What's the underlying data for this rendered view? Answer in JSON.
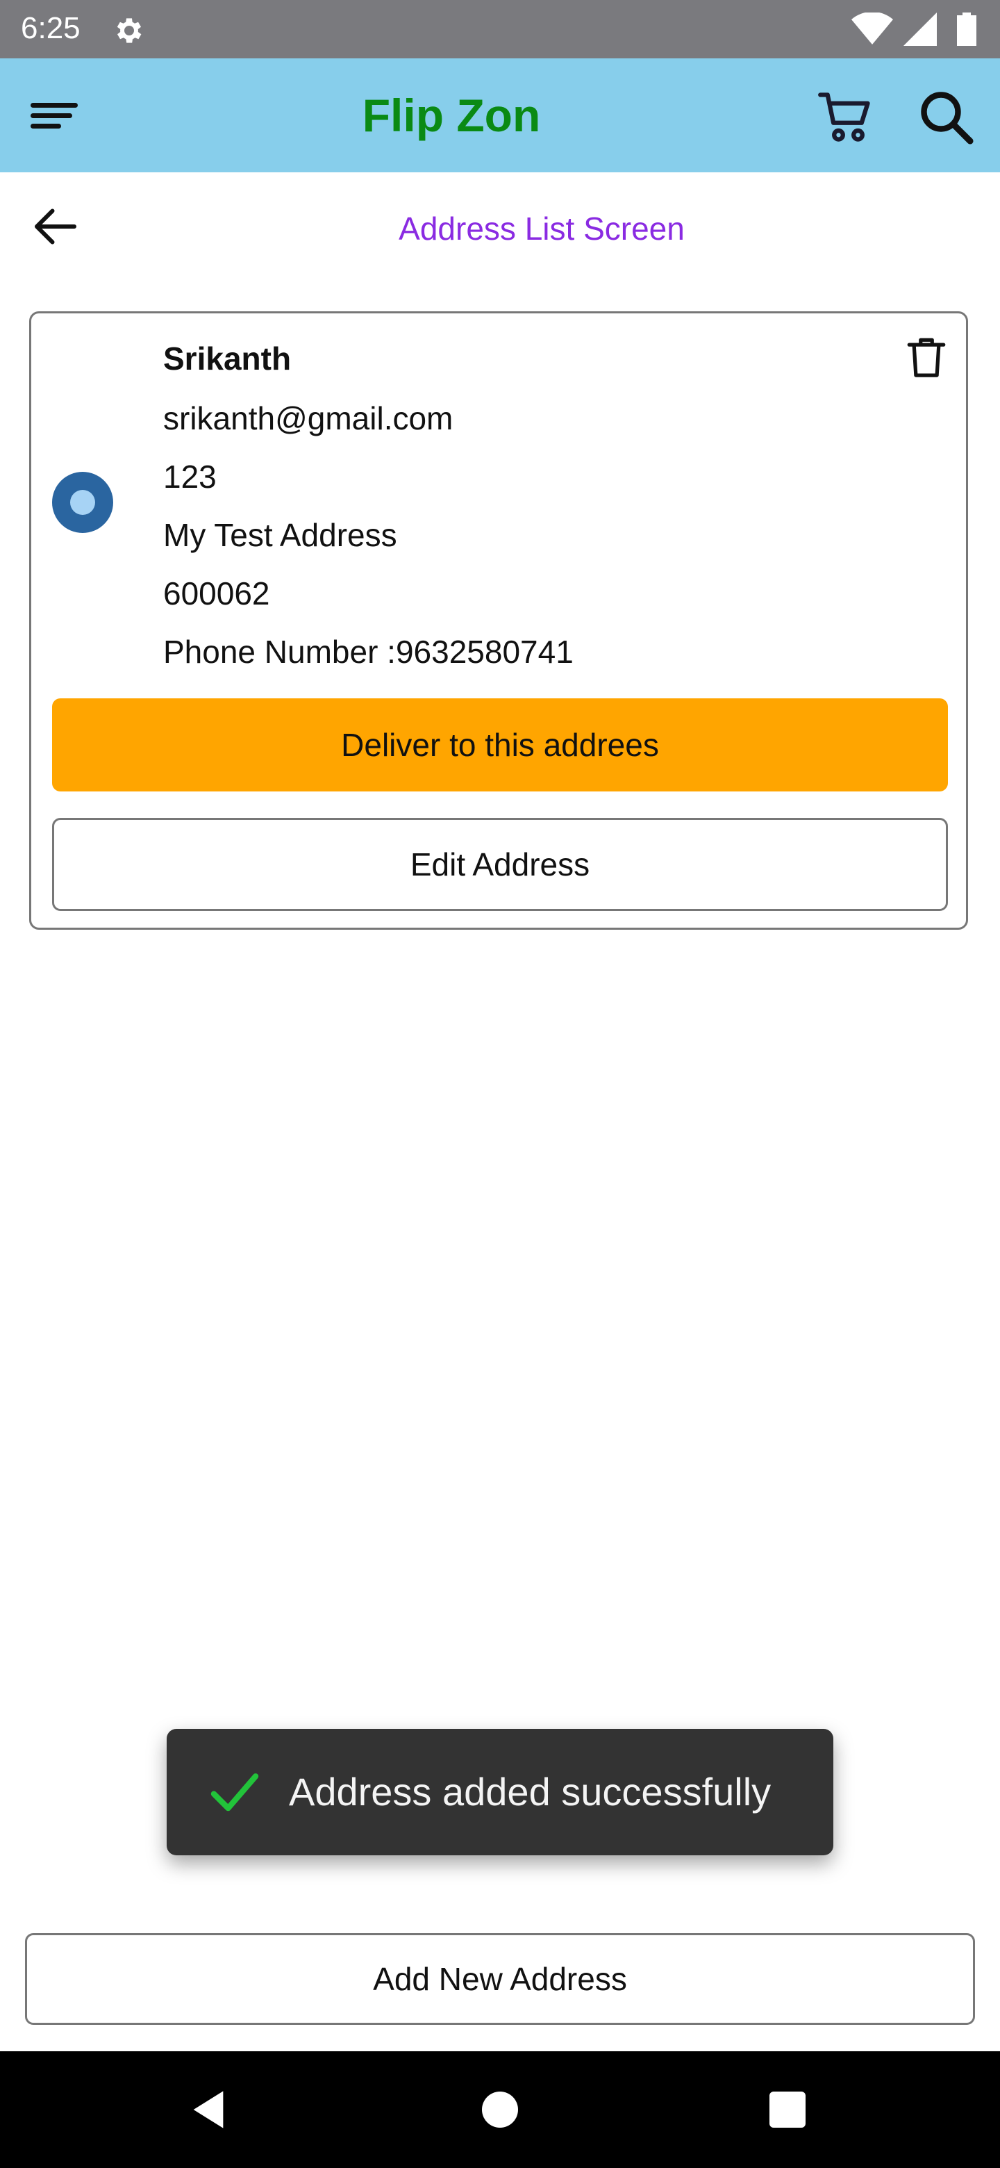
{
  "status_bar": {
    "time": "6:25"
  },
  "app_bar": {
    "title": "Flip Zon"
  },
  "screen": {
    "title": "Address List Screen"
  },
  "address": {
    "name": "Srikanth",
    "email": "srikanth@gmail.com",
    "house": "123",
    "street": "My Test Address",
    "pincode": "600062",
    "phone": "Phone Number :9632580741",
    "selected": true
  },
  "buttons": {
    "deliver": "Deliver to this addrees",
    "edit": "Edit Address",
    "add_new": "Add New Address"
  },
  "toast": {
    "message": "Address added successfully"
  },
  "colors": {
    "app_bar": "#87ceeb",
    "brand_title": "#0a8a14",
    "screen_title": "#8a2be2",
    "deliver_button": "#ffa500",
    "radio_selected": "#2a65a0",
    "toast_check": "#22c33a"
  },
  "icons": {
    "menu": "menu-icon",
    "cart": "cart-icon",
    "search": "search-icon",
    "back": "back-arrow-icon",
    "delete": "trash-icon",
    "toast": "check-icon"
  }
}
